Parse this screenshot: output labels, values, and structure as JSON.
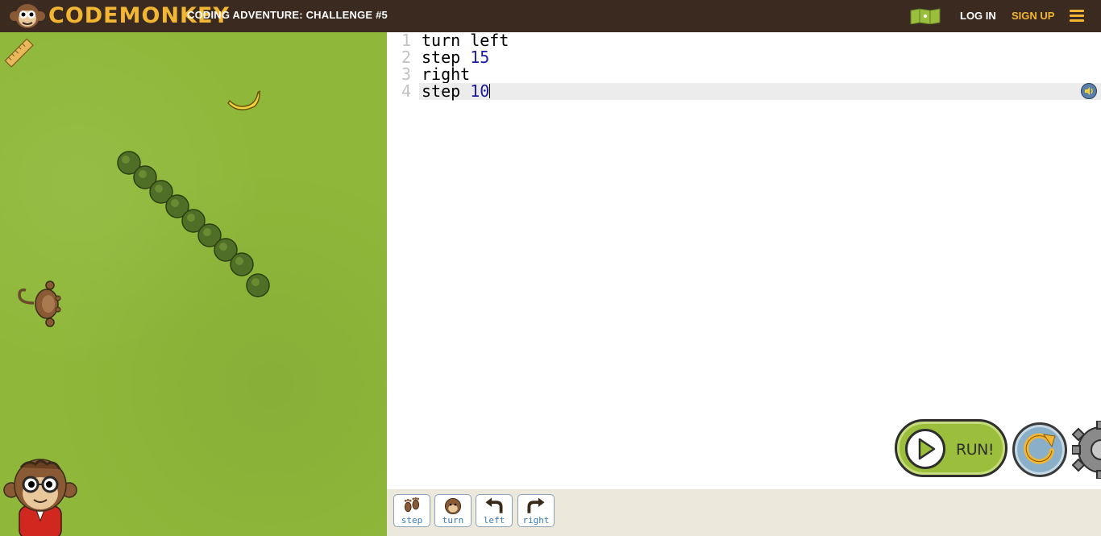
{
  "header": {
    "logo_text": "CODEMONKEY",
    "challenge_title": "CODING ADVENTURE: CHALLENGE #5",
    "login_label": "LOG IN",
    "signup_label": "SIGN UP"
  },
  "editor": {
    "lines": [
      {
        "num": "1",
        "keyword": "turn left",
        "arg": ""
      },
      {
        "num": "2",
        "keyword": "step ",
        "arg": "15"
      },
      {
        "num": "3",
        "keyword": "right",
        "arg": ""
      },
      {
        "num": "4",
        "keyword": "step ",
        "arg": "10"
      }
    ]
  },
  "controls": {
    "run_label": "RUN!"
  },
  "toolbar": {
    "tools": [
      {
        "label": "step",
        "icon": "footprints-icon"
      },
      {
        "label": "turn",
        "icon": "monkey-head-icon"
      },
      {
        "label": "left",
        "icon": "arrow-left-turn-icon"
      },
      {
        "label": "right",
        "icon": "arrow-right-turn-icon"
      }
    ]
  },
  "colors": {
    "header_bg": "#3a2a20",
    "accent": "#f2b632",
    "grass": "#8fb83a",
    "run_green": "#9bbf3c",
    "number_blue": "#1a1aa6"
  }
}
